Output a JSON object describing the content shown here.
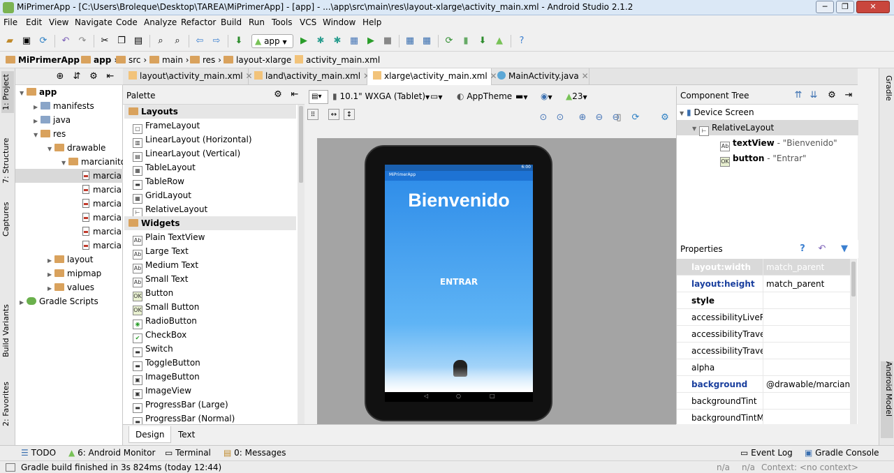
{
  "window": {
    "title": "MiPrimerApp - [C:\\Users\\Broleque\\Desktop\\TAREA\\MiPrimerApp] - [app] - ...\\app\\src\\main\\res\\layout-xlarge\\activity_main.xml - Android Studio 2.1.2",
    "minimize": "─",
    "maximize": "❐",
    "close": "✕"
  },
  "menu": [
    "File",
    "Edit",
    "View",
    "Navigate",
    "Code",
    "Analyze",
    "Refactor",
    "Build",
    "Run",
    "Tools",
    "VCS",
    "Window",
    "Help"
  ],
  "toolbar": {
    "run_config": "app"
  },
  "breadcrumb": [
    "MiPrimerApp",
    "app",
    "src",
    "main",
    "res",
    "layout-xlarge",
    "activity_main.xml"
  ],
  "left_tool_tabs": {
    "project": "1: Project",
    "structure": "7: Structure",
    "captures": "Captures",
    "build_variants": "Build Variants",
    "favorites": "2: Favorites"
  },
  "right_tool_tabs": {
    "gradle": "Gradle",
    "android_model": "Android Model"
  },
  "project_tree": [
    {
      "label": "app",
      "level": 0,
      "type": "folder",
      "expanded": true
    },
    {
      "label": "manifests",
      "level": 1,
      "type": "folder",
      "expanded": false
    },
    {
      "label": "java",
      "level": 1,
      "type": "folder",
      "expanded": false
    },
    {
      "label": "res",
      "level": 1,
      "type": "folder",
      "expanded": true
    },
    {
      "label": "drawable",
      "level": 2,
      "type": "folder",
      "expanded": true
    },
    {
      "label": "marcianito",
      "level": 3,
      "type": "folder",
      "expanded": true
    },
    {
      "label": "marcia",
      "level": 4,
      "type": "file",
      "selected": true
    },
    {
      "label": "marcia",
      "level": 4,
      "type": "file"
    },
    {
      "label": "marcia",
      "level": 4,
      "type": "file"
    },
    {
      "label": "marcia",
      "level": 4,
      "type": "file"
    },
    {
      "label": "marcia",
      "level": 4,
      "type": "file"
    },
    {
      "label": "marcia",
      "level": 4,
      "type": "file"
    },
    {
      "label": "layout",
      "level": 2,
      "type": "folder",
      "expanded": false
    },
    {
      "label": "mipmap",
      "level": 2,
      "type": "folder",
      "expanded": false
    },
    {
      "label": "values",
      "level": 2,
      "type": "folder",
      "expanded": false
    },
    {
      "label": "Gradle Scripts",
      "level": 0,
      "type": "gradle",
      "expanded": false
    }
  ],
  "editor_tabs": [
    {
      "label": "layout\\activity_main.xml",
      "active": false
    },
    {
      "label": "land\\activity_main.xml",
      "active": false
    },
    {
      "label": "xlarge\\activity_main.xml",
      "active": true
    },
    {
      "label": "MainActivity.java",
      "active": false
    }
  ],
  "palette": {
    "title": "Palette",
    "sections": [
      {
        "name": "Layouts",
        "items": [
          "FrameLayout",
          "LinearLayout (Horizontal)",
          "LinearLayout (Vertical)",
          "TableLayout",
          "TableRow",
          "GridLayout",
          "RelativeLayout"
        ]
      },
      {
        "name": "Widgets",
        "items": [
          "Plain TextView",
          "Large Text",
          "Medium Text",
          "Small Text",
          "Button",
          "Small Button",
          "RadioButton",
          "CheckBox",
          "Switch",
          "ToggleButton",
          "ImageButton",
          "ImageView",
          "ProgressBar (Large)",
          "ProgressBar (Normal)"
        ]
      }
    ]
  },
  "design_toolbar": {
    "device": "10.1\" WXGA (Tablet)",
    "theme": "AppTheme",
    "api": "23"
  },
  "preview": {
    "app_name": "MiPrimerApp",
    "status_time": "6:00",
    "text": "Bienvenido",
    "button": "ENTRAR",
    "nav": [
      "◁",
      "○",
      "□"
    ]
  },
  "component_tree": {
    "title": "Component Tree",
    "items": [
      {
        "label": "Device Screen",
        "detail": "",
        "level": 0
      },
      {
        "label": "RelativeLayout",
        "detail": "",
        "level": 1,
        "selected": true
      },
      {
        "label": "textView",
        "detail": " - \"Bienvenido\"",
        "level": 2
      },
      {
        "label": "button",
        "detail": " - \"Entrar\"",
        "level": 2
      }
    ]
  },
  "properties": {
    "title": "Properties",
    "rows": [
      {
        "name": "layout:width",
        "value": "match_parent",
        "style": "header"
      },
      {
        "name": "layout:height",
        "value": "match_parent",
        "style": "blue"
      },
      {
        "name": "style",
        "value": "",
        "style": "bold"
      },
      {
        "name": "accessibilityLiveRegion",
        "value": "",
        "style": ""
      },
      {
        "name": "accessibilityTraversalAfter",
        "value": "",
        "style": ""
      },
      {
        "name": "accessibilityTraversalBefore",
        "value": "",
        "style": ""
      },
      {
        "name": "alpha",
        "value": "",
        "style": ""
      },
      {
        "name": "background",
        "value": "@drawable/marcianito",
        "style": "blue"
      },
      {
        "name": "backgroundTint",
        "value": "",
        "style": ""
      },
      {
        "name": "backgroundTintMode",
        "value": "",
        "style": ""
      }
    ]
  },
  "bottom_tabs": [
    {
      "label": "Design",
      "active": true
    },
    {
      "label": "Text",
      "active": false
    }
  ],
  "tool_windows": {
    "todo": "TODO",
    "android_monitor": "6: Android Monitor",
    "terminal": "Terminal",
    "messages": "0: Messages",
    "event_log": "Event Log",
    "gradle_console": "Gradle Console"
  },
  "status": {
    "message": "Gradle build finished in 3s 824ms (today 12:44)",
    "na1": "n/a",
    "na2": "n/a",
    "context": "Context: <no context>"
  },
  "colors": {
    "accent": "#2b8ae8",
    "selection": "#d9d9d9",
    "link_blue": "#1a3f9e"
  }
}
